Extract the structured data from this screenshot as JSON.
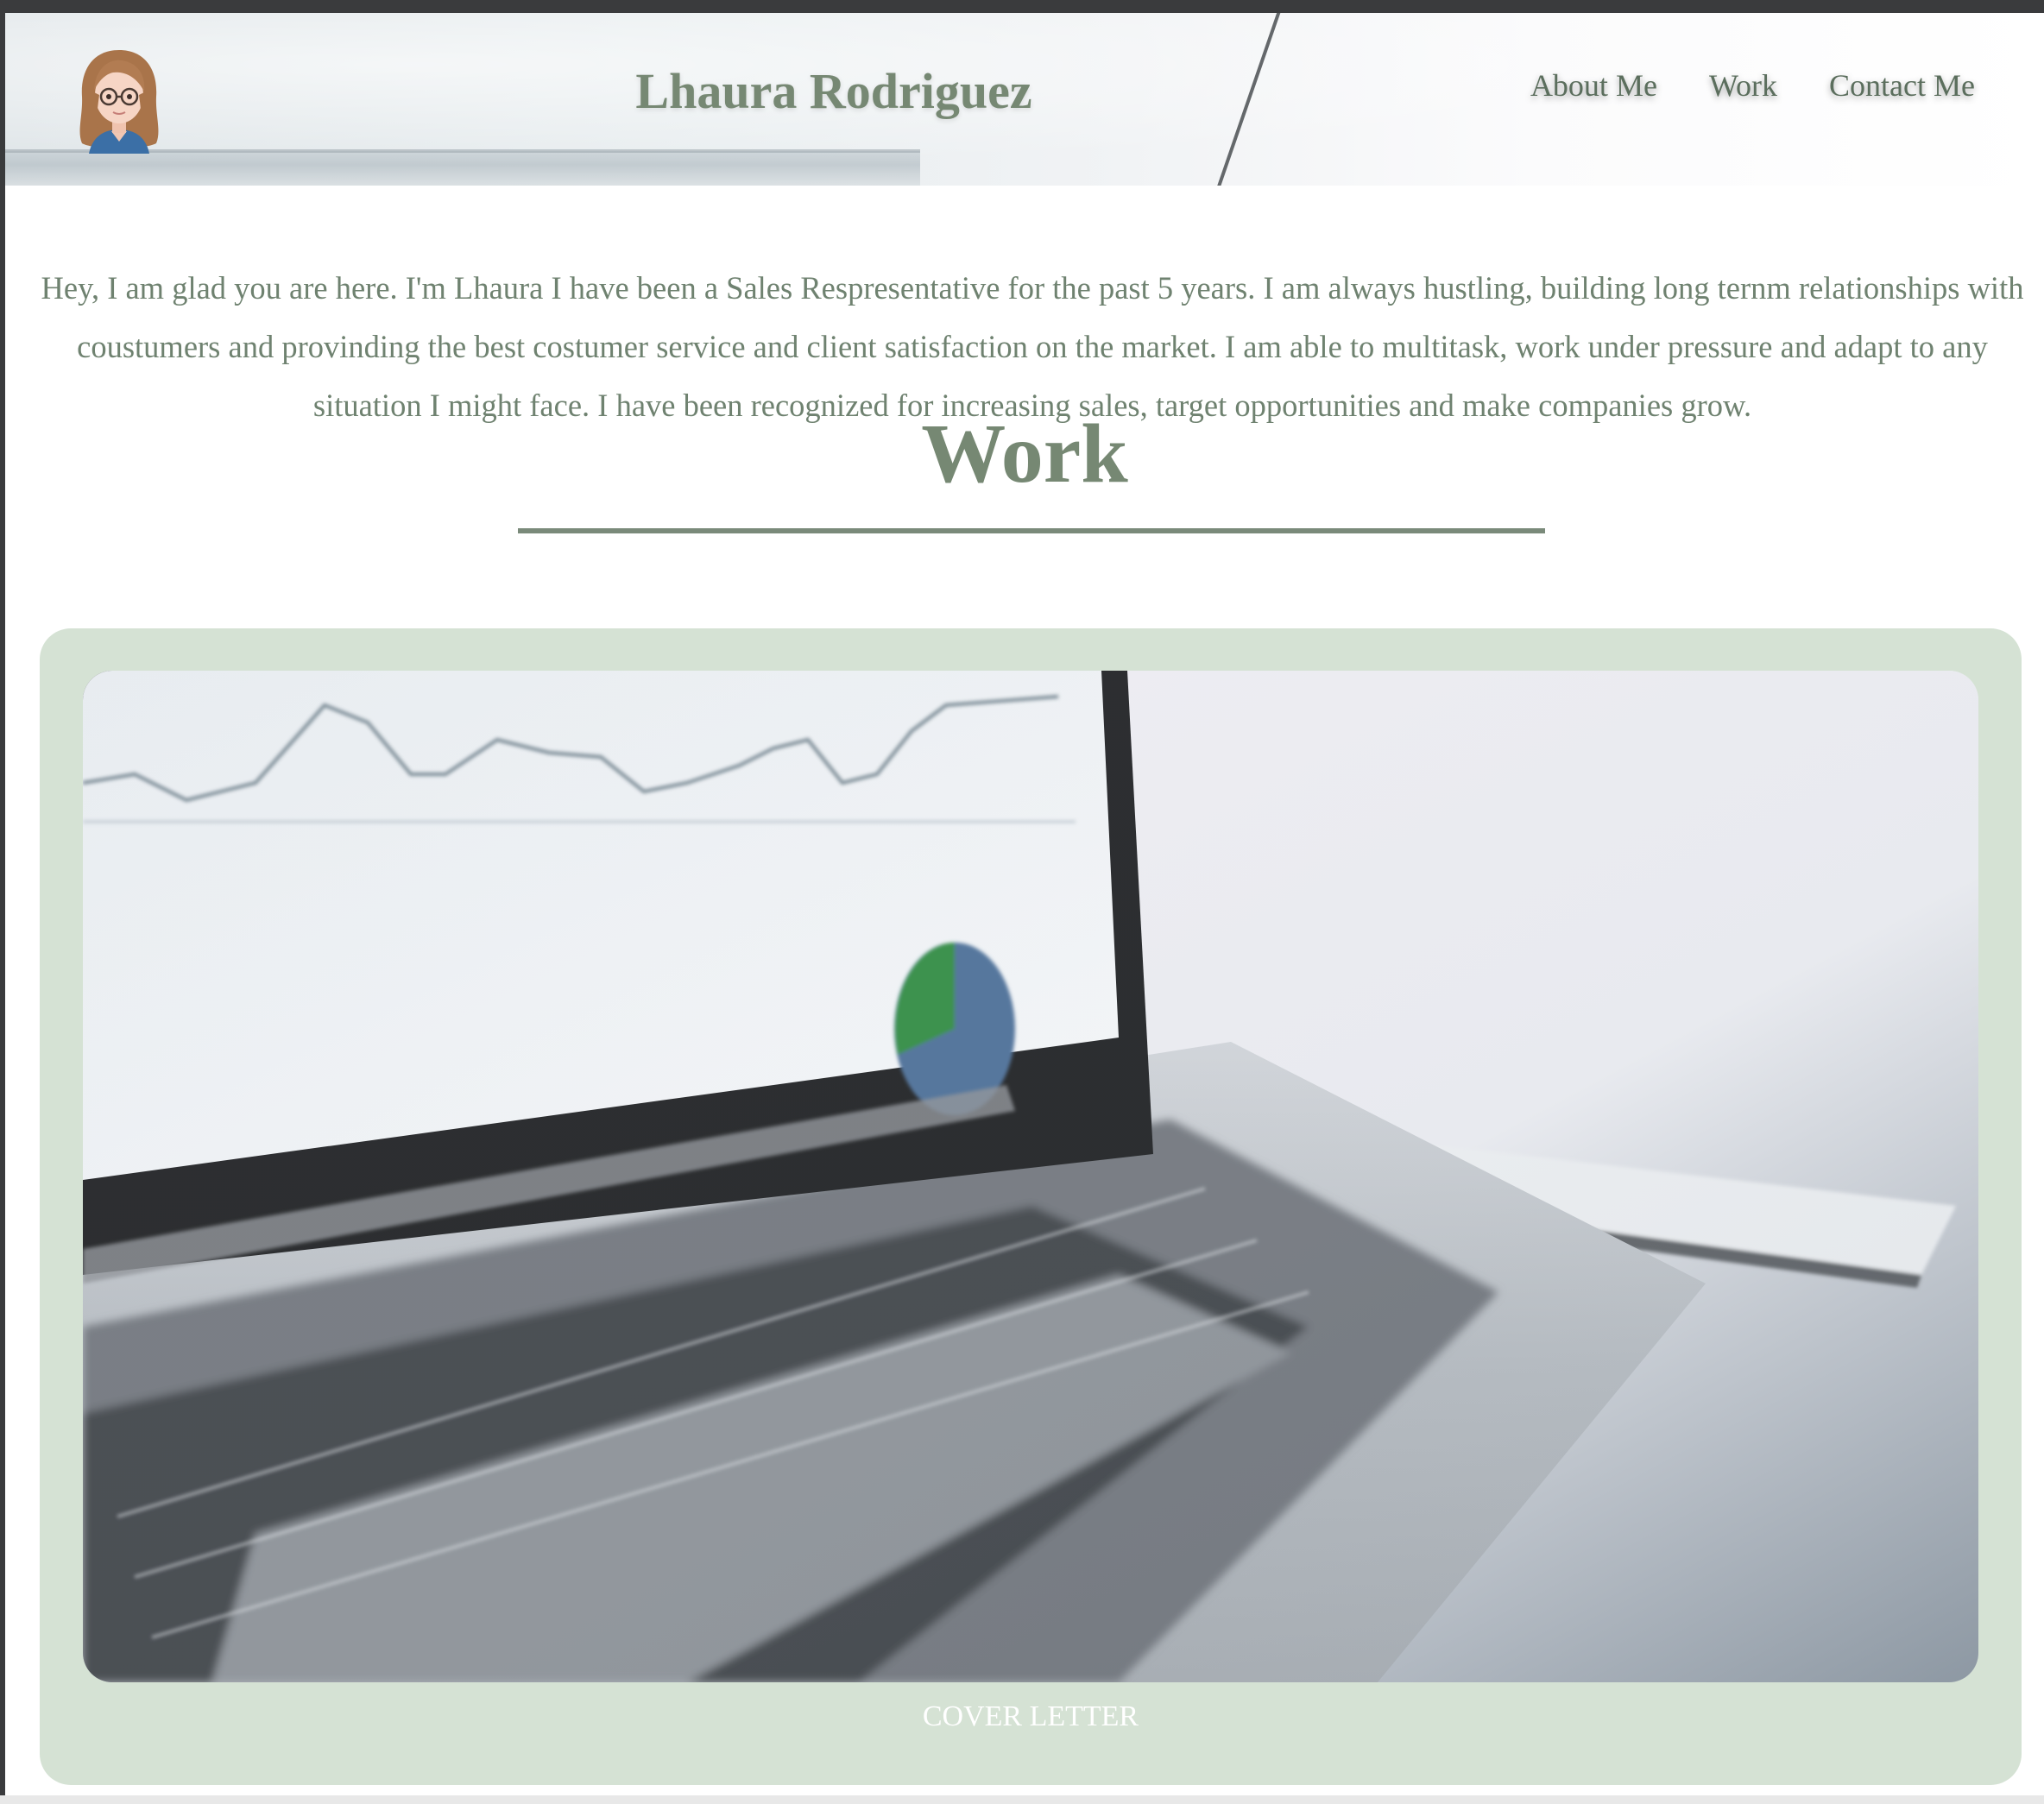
{
  "header": {
    "site_title": "Lhaura Rodriguez",
    "nav": {
      "about": "About Me",
      "work": "Work",
      "contact": "Contact Me"
    }
  },
  "intro": {
    "text": "Hey, I am glad you are here. I'm Lhaura I have been a Sales Respresentative for the past 5 years. I am always hustling, building long ternm relationships with coustumers and provinding the best costumer service and client satisfaction on the market. I am able to multitask, work under pressure and adapt to any situation I might face. I have been recognized for increasing sales, target opportunities and make companies grow."
  },
  "work": {
    "heading": "Work",
    "card": {
      "caption": "COVER LETTER"
    }
  },
  "colors": {
    "accent_green": "#768873",
    "card_background": "#d5e2d4",
    "divider": "#7a8a7a"
  }
}
